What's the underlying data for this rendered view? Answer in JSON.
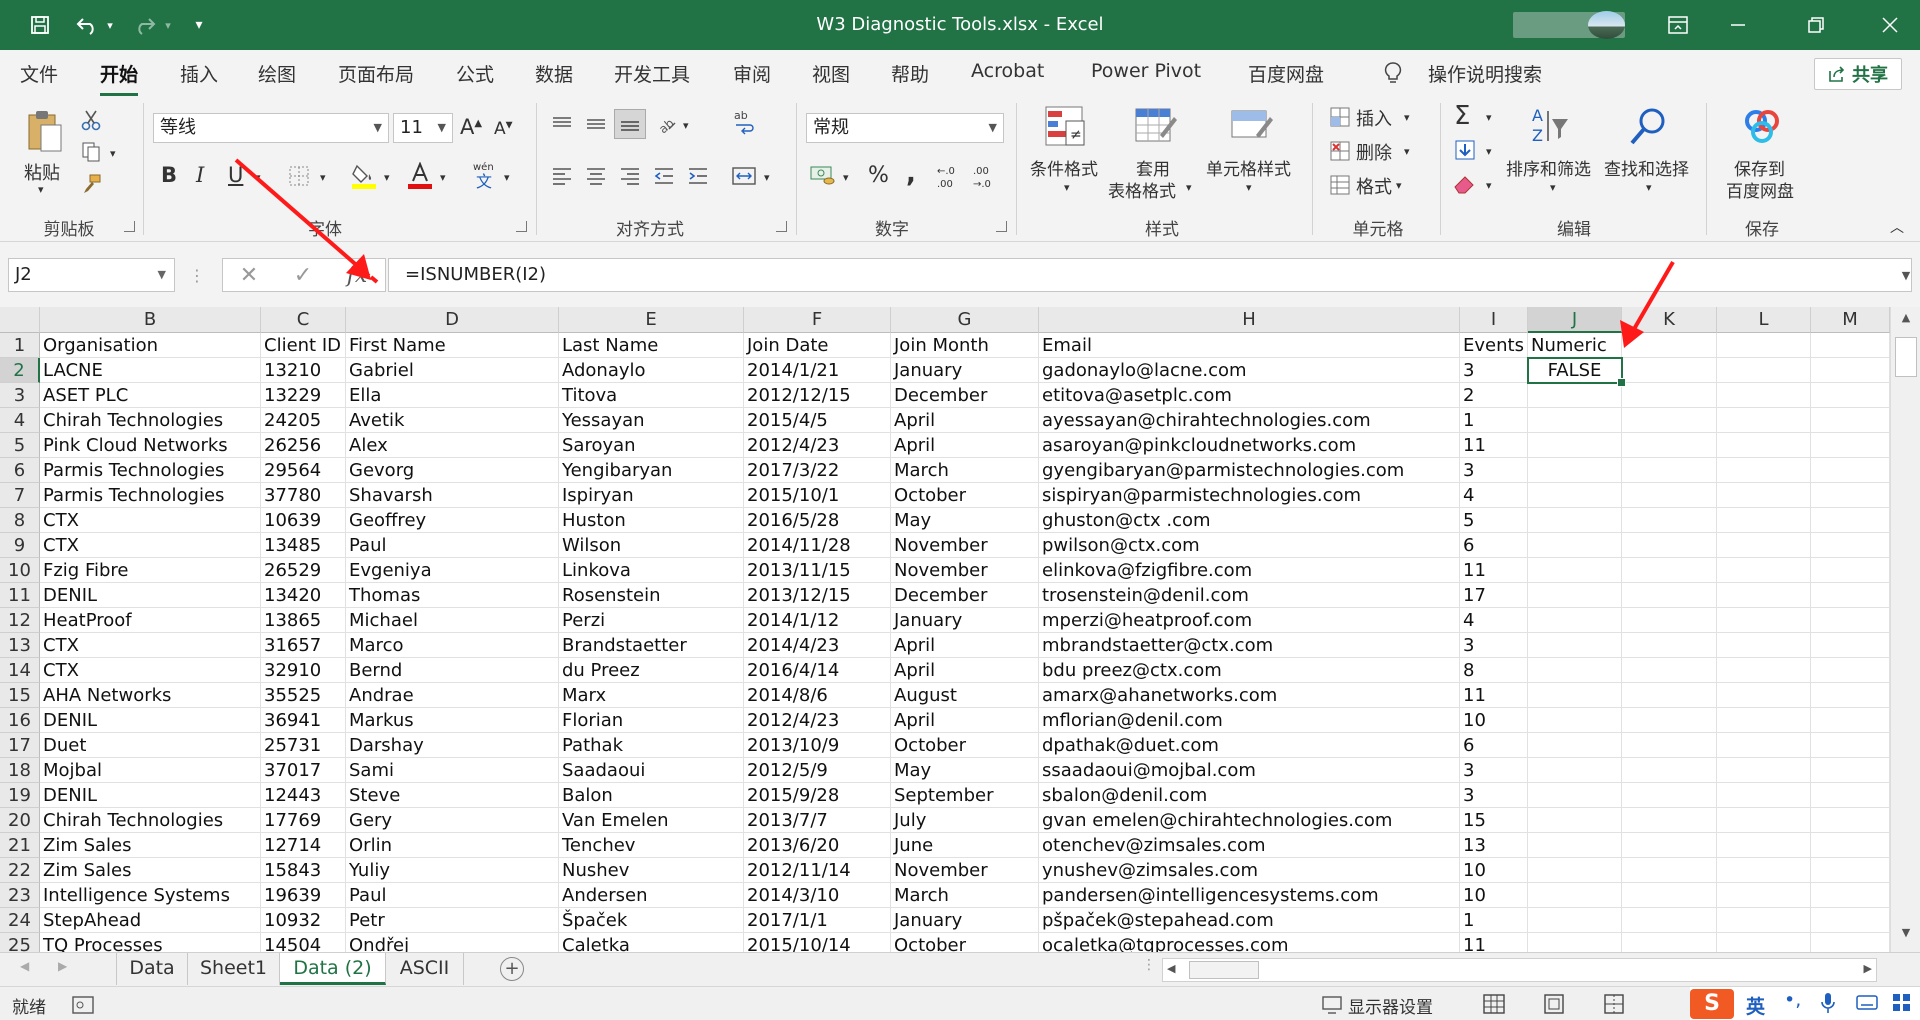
{
  "window": {
    "title": "W3 Diagnostic Tools.xlsx  -  Excel",
    "qat_more": "▾"
  },
  "menu": {
    "tabs": [
      "文件",
      "开始",
      "插入",
      "绘图",
      "页面布局",
      "公式",
      "数据",
      "开发工具",
      "审阅",
      "视图",
      "帮助",
      "Acrobat",
      "Power Pivot",
      "百度网盘"
    ],
    "active_tab": "开始",
    "tell_me": "操作说明搜索",
    "share": "共享"
  },
  "ribbon": {
    "clipboard": {
      "paste": "粘贴",
      "label": "剪贴板"
    },
    "font": {
      "name": "等线",
      "size": "11",
      "bold": "B",
      "italic": "I",
      "underline": "U",
      "grow": "A",
      "shrink": "A",
      "label": "字体"
    },
    "alignment": {
      "label": "对齐方式"
    },
    "number": {
      "format": "常规",
      "percent": "%",
      "comma": ",",
      "label": "数字"
    },
    "styles": {
      "conditional": "条件格式",
      "table_line1": "套用",
      "table_line2": "表格格式",
      "cell_styles": "单元格样式",
      "label": "样式"
    },
    "cells": {
      "insert": "插入",
      "delete": "删除",
      "format": "格式",
      "label": "单元格"
    },
    "editing": {
      "sort": "排序和筛选",
      "find": "查找和选择",
      "label": "编辑"
    },
    "save": {
      "line1": "保存到",
      "line2": "百度网盘",
      "label": "保存"
    }
  },
  "formula_bar": {
    "name_box": "J2",
    "cancel": "✕",
    "enter": "✓",
    "fx": "fx",
    "formula": "=ISNUMBER(I2)"
  },
  "columns": [
    "B",
    "C",
    "D",
    "E",
    "F",
    "G",
    "H",
    "I",
    "J",
    "K",
    "L",
    "M"
  ],
  "selected_column": "J",
  "selected_row": "2",
  "rows": [
    {
      "n": "1",
      "org": "Organisation",
      "id": "Client ID",
      "first": "First Name",
      "last": "Last Name",
      "join": "Join Date",
      "month": "Join Month",
      "email": "Email",
      "events": "Events",
      "numeric": "Numeric"
    },
    {
      "n": "2",
      "org": "LACNE",
      "id": "13210",
      "first": "Gabriel",
      "last": "Adonaylo",
      "join": "2014/1/21",
      "month": "January",
      "email": "gadonaylo@lacne.com",
      "events": "3",
      "numeric": "FALSE"
    },
    {
      "n": "3",
      "org": "ASET PLC",
      "id": "13229",
      "first": "Ella",
      "last": "Titova",
      "join": "2012/12/15",
      "month": "December",
      "email": "etitova@asetplc.com",
      "events": "2",
      "numeric": ""
    },
    {
      "n": "4",
      "org": "Chirah Technologies",
      "id": "24205",
      "first": "Avetik",
      "last": "Yessayan",
      "join": "2015/4/5",
      "month": "April",
      "email": "ayessayan@chirahtechnologies.com",
      "events": "1",
      "numeric": ""
    },
    {
      "n": "5",
      "org": "Pink Cloud Networks",
      "id": "26256",
      "first": "Alex",
      "last": "Saroyan",
      "join": "2012/4/23",
      "month": "April",
      "email": "asaroyan@pinkcloudnetworks.com",
      "events": "11",
      "numeric": ""
    },
    {
      "n": "6",
      "org": "Parmis Technologies",
      "id": "29564",
      "first": "Gevorg",
      "last": "Yengibaryan",
      "join": "2017/3/22",
      "month": "March",
      "email": "gyengibaryan@parmistechnologies.com",
      "events": "3",
      "numeric": ""
    },
    {
      "n": "7",
      "org": "Parmis Technologies",
      "id": "37780",
      "first": "Shavarsh",
      "last": "Ispiryan",
      "join": "2015/10/1",
      "month": "October",
      "email": "sispiryan@parmistechnologies.com",
      "events": "4",
      "numeric": ""
    },
    {
      "n": "8",
      "org": "CTX",
      "id": "10639",
      "first": "Geoffrey",
      "last": "Huston",
      "join": "2016/5/28",
      "month": "May",
      "email": "ghuston@ctx .com",
      "events": "5",
      "numeric": ""
    },
    {
      "n": "9",
      "org": "CTX",
      "id": "13485",
      "first": "Paul",
      "last": "Wilson",
      "join": "2014/11/28",
      "month": "November",
      "email": "pwilson@ctx.com",
      "events": "6",
      "numeric": ""
    },
    {
      "n": "10",
      "org": "Fzig Fibre",
      "id": "26529",
      "first": "Evgeniya",
      "last": "Linkova",
      "join": "2013/11/15",
      "month": "November",
      "email": "elinkova@fzigfibre.com",
      "events": "11",
      "numeric": ""
    },
    {
      "n": "11",
      "org": "DENIL",
      "id": "13420",
      "first": "Thomas",
      "last": "Rosenstein",
      "join": "2013/12/15",
      "month": "December",
      "email": "trosenstein@denil.com",
      "events": "17",
      "numeric": ""
    },
    {
      "n": "12",
      "org": "HeatProof",
      "id": "13865",
      "first": "Michael",
      "last": "Perzi",
      "join": "2014/1/12",
      "month": "January",
      "email": "mperzi@heatproof.com",
      "events": "4",
      "numeric": ""
    },
    {
      "n": "13",
      "org": "CTX",
      "id": "31657",
      "first": "Marco",
      "last": "Brandstaetter",
      "join": "2014/4/23",
      "month": "April",
      "email": "mbrandstaetter@ctx.com",
      "events": "3",
      "numeric": ""
    },
    {
      "n": "14",
      "org": "CTX",
      "id": "32910",
      "first": "Bernd",
      "last": "du Preez",
      "join": "2016/4/14",
      "month": "April",
      "email": "bdu preez@ctx.com",
      "events": "8",
      "numeric": ""
    },
    {
      "n": "15",
      "org": "AHA Networks",
      "id": "35525",
      "first": "Andrae",
      "last": "Marx",
      "join": "2014/8/6",
      "month": "August",
      "email": "amarx@ahanetworks.com",
      "events": "11",
      "numeric": ""
    },
    {
      "n": "16",
      "org": "DENIL",
      "id": "36941",
      "first": "Markus",
      "last": "Florian",
      "join": "2012/4/23",
      "month": "April",
      "email": "mflorian@denil.com",
      "events": "10",
      "numeric": ""
    },
    {
      "n": "17",
      "org": "Duet",
      "id": "25731",
      "first": "Darshay",
      "last": "Pathak",
      "join": "2013/10/9",
      "month": "October",
      "email": "dpathak@duet.com",
      "events": "6",
      "numeric": ""
    },
    {
      "n": "18",
      "org": "Mojbal",
      "id": "37017",
      "first": "Sami",
      "last": "Saadaoui",
      "join": "2012/5/9",
      "month": "May",
      "email": "ssaadaoui@mojbal.com",
      "events": "3",
      "numeric": ""
    },
    {
      "n": "19",
      "org": "DENIL",
      "id": "12443",
      "first": "Steve",
      "last": "Balon",
      "join": "2015/9/28",
      "month": "September",
      "email": "sbalon@denil.com",
      "events": "3",
      "numeric": ""
    },
    {
      "n": "20",
      "org": "Chirah Technologies",
      "id": "17769",
      "first": "Gery",
      "last": "Van Emelen",
      "join": "2013/7/7",
      "month": "July",
      "email": "gvan emelen@chirahtechnologies.com",
      "events": "15",
      "numeric": ""
    },
    {
      "n": "21",
      "org": "Zim Sales",
      "id": "12714",
      "first": "Orlin",
      "last": "Tenchev",
      "join": "2013/6/20",
      "month": "June",
      "email": "otenchev@zimsales.com",
      "events": "13",
      "numeric": ""
    },
    {
      "n": "22",
      "org": "Zim Sales",
      "id": "15843",
      "first": "Yuliy",
      "last": "Nushev",
      "join": "2012/11/14",
      "month": "November",
      "email": "ynushev@zimsales.com",
      "events": "10",
      "numeric": ""
    },
    {
      "n": "23",
      "org": "Intelligence Systems",
      "id": "19639",
      "first": "Paul",
      "last": "Andersen",
      "join": "2014/3/10",
      "month": "March",
      "email": "pandersen@intelligencesystems.com",
      "events": "10",
      "numeric": ""
    },
    {
      "n": "24",
      "org": "StepAhead",
      "id": "10932",
      "first": "Petr",
      "last": "Špaček",
      "join": "2017/1/1",
      "month": "January",
      "email": "pšpaček@stepahead.com",
      "events": "1",
      "numeric": ""
    },
    {
      "n": "25",
      "org": "TQ Processes",
      "id": "14504",
      "first": "Ondřej",
      "last": "Caletka",
      "join": "2015/10/14",
      "month": "October",
      "email": "ocaletka@tqprocesses.com",
      "events": "11",
      "numeric": ""
    }
  ],
  "sheets": [
    "Data",
    "Sheet1",
    "Data (2)",
    "ASCII"
  ],
  "active_sheet": "Data (2)",
  "status": {
    "ready": "就绪",
    "display_settings": "显示器设置",
    "ime_lang": "英"
  },
  "colors": {
    "excel_green": "#217346",
    "annotation_arrow": "#ff1a1a"
  }
}
